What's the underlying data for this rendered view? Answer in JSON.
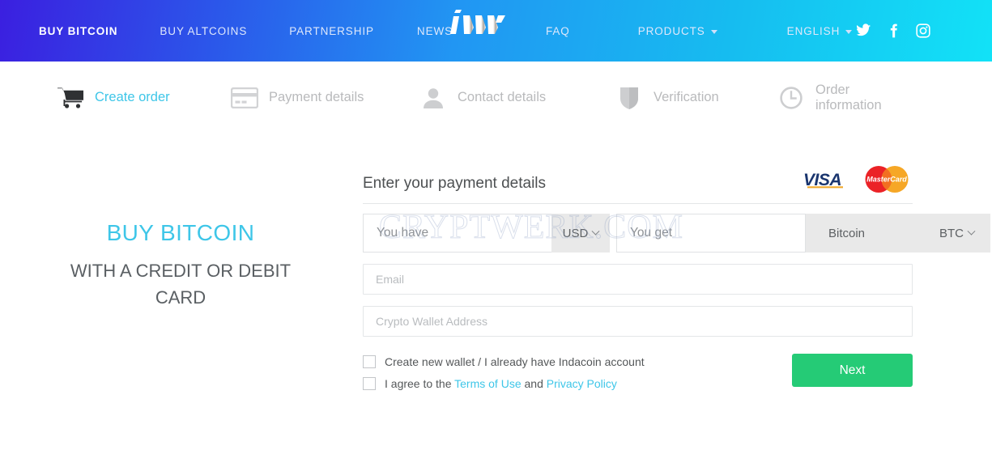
{
  "nav": {
    "items": [
      {
        "label": "BUY BITCOIN",
        "active": true,
        "caret": false
      },
      {
        "label": "BUY ALTCOINS",
        "active": false,
        "caret": false
      },
      {
        "label": "PARTNERSHIP",
        "active": false,
        "caret": false
      },
      {
        "label": "NEWS",
        "active": false,
        "caret": false
      },
      {
        "label": "FAQ",
        "active": false,
        "caret": false
      },
      {
        "label": "PRODUCTS",
        "active": false,
        "caret": true
      },
      {
        "label": "ENGLISH",
        "active": false,
        "caret": true
      }
    ],
    "logo_alt": "Indacoin logo",
    "socials": [
      {
        "name": "twitter-icon"
      },
      {
        "name": "facebook-icon"
      },
      {
        "name": "instagram-icon"
      }
    ],
    "gradient_from": "#3b1fe0",
    "gradient_to": "#12e2f7"
  },
  "steps": [
    {
      "label": "Create order",
      "icon": "shopping-cart-icon",
      "active": true
    },
    {
      "label": "Payment details",
      "icon": "credit-card-icon",
      "active": false
    },
    {
      "label": "Contact details",
      "icon": "person-icon",
      "active": false
    },
    {
      "label": "Verification",
      "icon": "shield-icon",
      "active": false
    },
    {
      "label": "Order information",
      "icon": "clock-icon",
      "active": false
    }
  ],
  "hero": {
    "title": "BUY BITCOIN",
    "subtitle": "WITH A CREDIT OR DEBIT CARD",
    "title_color": "#3ec6e8"
  },
  "form": {
    "title": "Enter your payment details",
    "cards": [
      "VISA",
      "MasterCard"
    ],
    "you_have_placeholder": "You have",
    "you_have_value": "",
    "fiat_currency": "USD",
    "you_get_placeholder": "You get",
    "you_get_value": "",
    "coin_name": "Bitcoin",
    "coin_currency": "BTC",
    "email_placeholder": "Email",
    "email_value": "",
    "wallet_placeholder": "Crypto Wallet Address",
    "wallet_value": "",
    "checkbox_wallet": "Create new wallet / I already have Indacoin account",
    "agree_prefix": "I agree to the ",
    "agree_terms": "Terms of Use",
    "agree_and": " and ",
    "agree_privacy": "Privacy Policy",
    "next_label": "Next",
    "next_color": "#25cb76"
  },
  "watermark": {
    "text": "CRYPTWERK.COM"
  }
}
